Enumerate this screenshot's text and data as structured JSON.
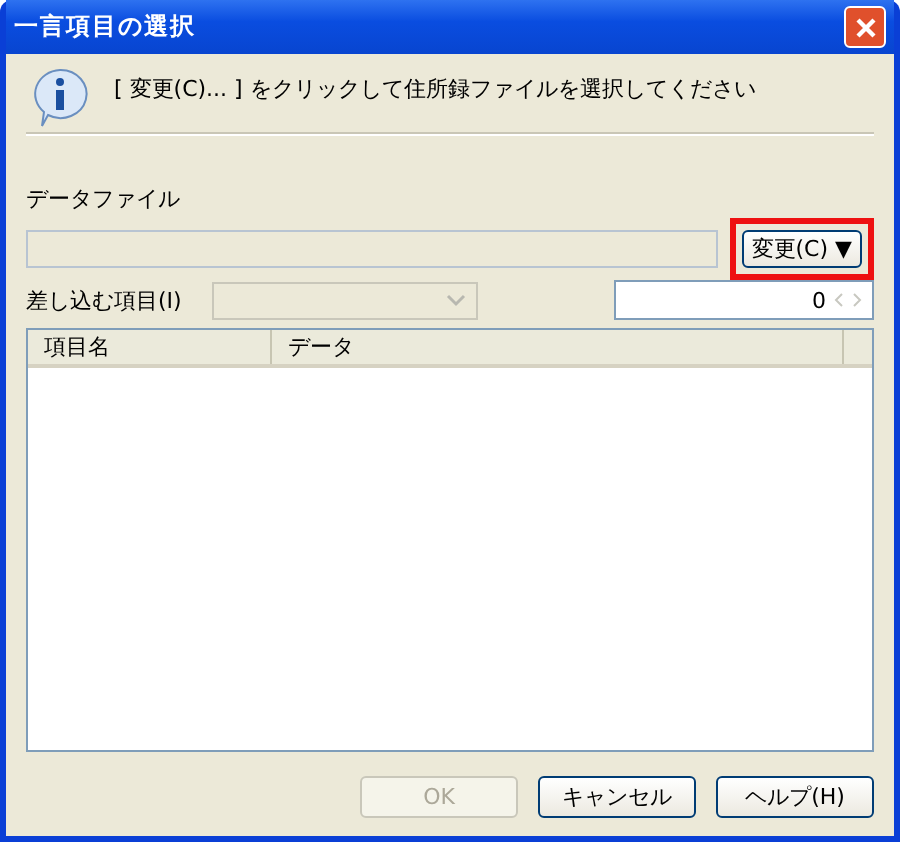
{
  "window": {
    "title": "一言項目の選択"
  },
  "message": "[ 変更(C)... ] をクリックして住所録ファイルを選択してください",
  "data_file": {
    "label": "データファイル",
    "change_button": {
      "label": "変更(C) ▼",
      "highlighted": true
    }
  },
  "insert_item": {
    "label": "差し込む項目(I)",
    "combo_disabled": true,
    "count": "0"
  },
  "table": {
    "columns": [
      "項目名",
      "データ"
    ]
  },
  "buttons": [
    {
      "label": "OK",
      "disabled": true
    },
    {
      "label": "キャンセル",
      "disabled": false
    },
    {
      "label": "ヘルプ(H)",
      "disabled": false
    }
  ]
}
